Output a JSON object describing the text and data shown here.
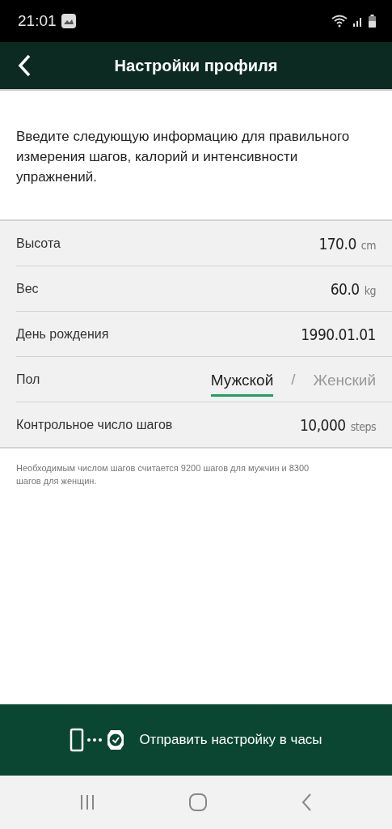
{
  "status_bar": {
    "time": "21:01"
  },
  "header": {
    "title": "Настройки профиля"
  },
  "intro": "Введите следующую информацию для правильного измерения шагов, калорий и интенсивности упражнений.",
  "rows": [
    {
      "kind": "value",
      "label": "Высота",
      "value": "170.0",
      "unit": "cm"
    },
    {
      "kind": "value",
      "label": "Вес",
      "value": "60.0",
      "unit": "kg"
    },
    {
      "kind": "value",
      "label": "День рождения",
      "value": "1990.01.01"
    },
    {
      "kind": "choice",
      "label": "Пол",
      "separator": "/",
      "options": [
        {
          "label": "Мужской",
          "selected": true
        },
        {
          "label": "Женский",
          "selected": false
        }
      ]
    },
    {
      "kind": "value",
      "label": "Контрольное число шагов",
      "value": "10,000",
      "unit": "steps"
    }
  ],
  "note": "Необходимым числом шагов считается 9200 шагов для мужчин и 8300 шагов для женщин.",
  "send_button": {
    "label": "Отправить настройку в часы"
  }
}
